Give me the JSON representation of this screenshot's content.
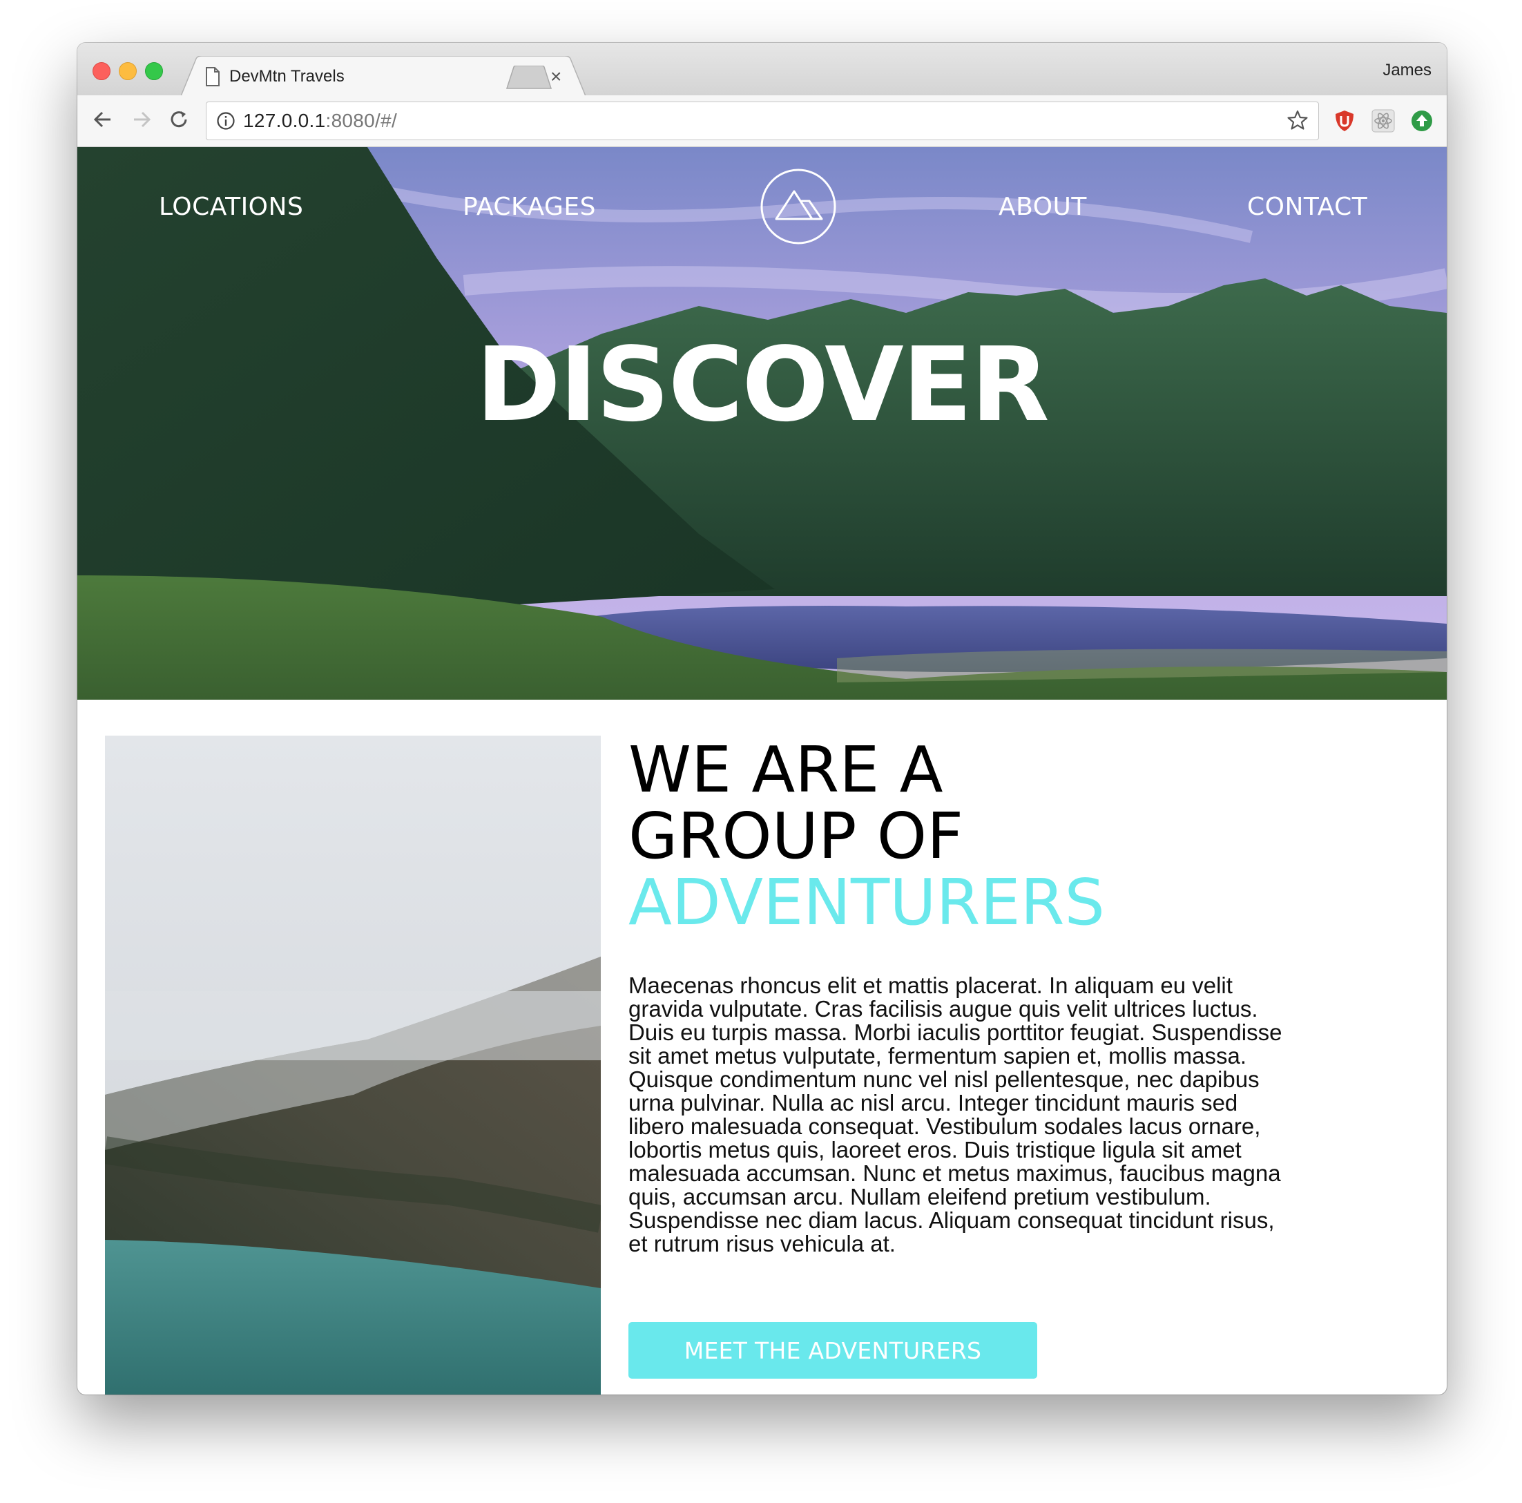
{
  "browser": {
    "tab_title": "DevMtn Travels",
    "tab_close": "×",
    "profile_name": "James",
    "url_host": "127.0.0.1",
    "url_rest": ":8080/#/",
    "icons": [
      "back-arrow-icon",
      "forward-arrow-icon",
      "reload-icon",
      "info-icon",
      "star-icon",
      "ublock-icon",
      "react-devtools-icon",
      "upload-extension-icon",
      "document-icon"
    ]
  },
  "nav": {
    "locations": "LOCATIONS",
    "packages": "PACKAGES",
    "about": "ABOUT",
    "contact": "CONTACT",
    "logo_icon": "mountain-logo-icon"
  },
  "hero": {
    "title": "DISCOVER"
  },
  "about": {
    "headline_line1": "WE ARE A",
    "headline_line2": "GROUP OF",
    "headline_accent": "ADVENTURERS",
    "body": "Maecenas rhoncus elit et mattis placerat. In aliquam eu velit gravida vulputate. Cras facilisis augue quis velit ultrices luctus. Duis eu turpis massa. Morbi iaculis porttitor feugiat. Suspendisse sit amet metus vulputate, fermentum sapien et, mollis massa. Quisque condimentum nunc vel nisl pellentesque, nec dapibus urna pulvinar. Nulla ac nisl arcu. Integer tincidunt mauris sed libero malesuada consequat. Vestibulum sodales lacus ornare, lobortis metus quis, laoreet eros. Duis tristique ligula sit amet malesuada accumsan. Nunc et metus maximus, faucibus magna quis, accumsan arcu. Nullam eleifend pretium vestibulum. Suspendisse nec diam lacus. Aliquam consequat tincidunt risus, et rutrum risus vehicula at.",
    "button_label": "MEET THE ADVENTURERS"
  },
  "colors": {
    "accent": "#6ae9ec",
    "button": "#69e8ec"
  }
}
